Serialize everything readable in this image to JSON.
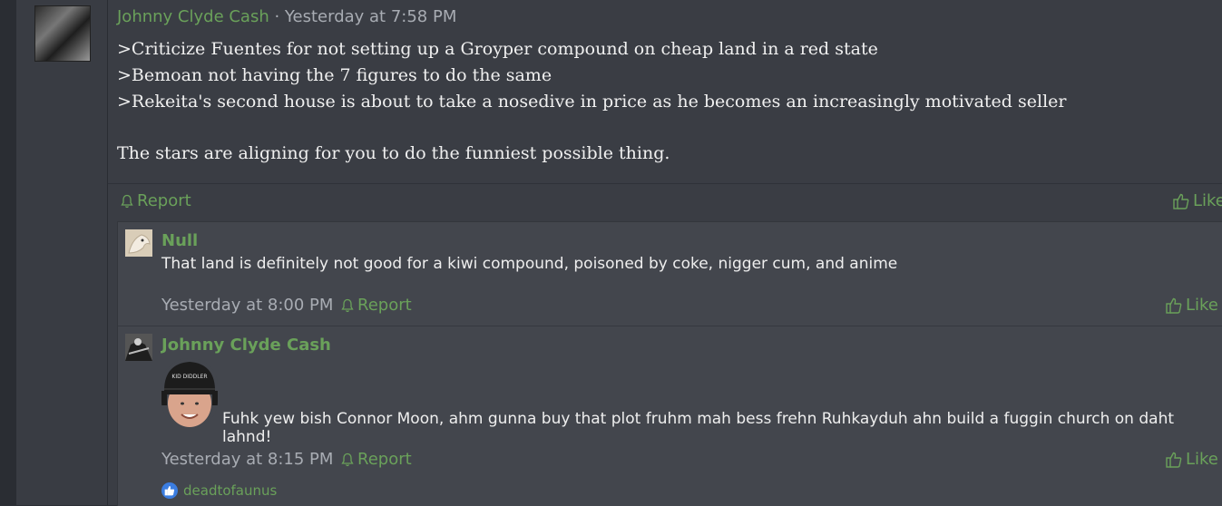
{
  "post": {
    "author": "Johnny Clyde Cash",
    "separator": " · ",
    "timestamp": "Yesterday at 7:58 PM",
    "lines": [
      ">Criticize Fuentes for not setting up a Groyper compound on cheap land in a red state",
      ">Bemoan not having the 7 figures to do the same",
      ">Rekeita's second house is about to take a nosedive in price as he becomes an increasingly motivated seller"
    ],
    "closing": "The stars are aligning for you to do the funniest possible thing.",
    "report_label": "Report",
    "like_label": "Like"
  },
  "replies": [
    {
      "author": "Null",
      "text": "That land is definitely not good for a kiwi compound, poisoned by coke, nigger cum, and anime",
      "timestamp": "Yesterday at 8:00 PM",
      "report_label": "Report",
      "like_label": "Like"
    },
    {
      "author": "Johnny Clyde Cash",
      "image_caption": "KID DIDDLER",
      "text": "Fuhk yew bish Connor Moon, ahm gunna buy that plot fruhm mah bess frehn Ruhkayduh ahn build a fuggin church on daht lahnd!",
      "timestamp": "Yesterday at 8:15 PM",
      "report_label": "Report",
      "like_label": "Like",
      "reaction_user": "deadtofaunus"
    }
  ],
  "colors": {
    "accent": "#6aa15a",
    "background": "#3a3d44",
    "reply_background": "#43464d",
    "reaction_blue": "#3b7de0"
  }
}
